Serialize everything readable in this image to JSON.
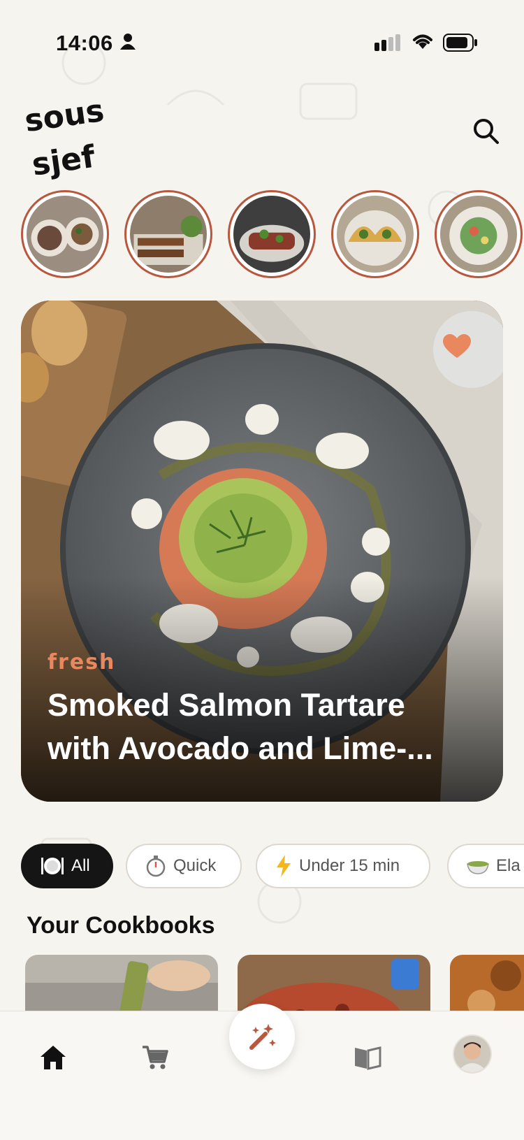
{
  "status_bar": {
    "time": "14:06"
  },
  "app": {
    "logo_line1": "sous",
    "logo_line2": "sjef"
  },
  "stories": [
    {
      "icon": "bowl-food"
    },
    {
      "icon": "skewers-food"
    },
    {
      "icon": "steak-food"
    },
    {
      "icon": "tacos-food"
    },
    {
      "icon": "salad-food"
    }
  ],
  "featured": {
    "tag": "fresh",
    "title_line1": "Smoked Salmon Tartare",
    "title_line2": "with Avocado and Lime-...",
    "favorite": true,
    "accent": "#e9875f"
  },
  "filters": [
    {
      "icon": "plate-cutlery",
      "label": "All",
      "active": true
    },
    {
      "icon": "stopwatch",
      "label": "Quick",
      "active": false
    },
    {
      "icon": "lightning",
      "label": "Under 15 min",
      "active": false
    },
    {
      "icon": "bowl",
      "label": "Ela",
      "active": false
    }
  ],
  "cookbooks": {
    "title": "Your Cookbooks"
  },
  "tabbar": {
    "items": [
      "home-icon",
      "cart-icon",
      "magic-wand-icon",
      "book-icon",
      "avatar"
    ]
  },
  "colors": {
    "brand": "#b9573e",
    "background": "#f6f4ef"
  }
}
